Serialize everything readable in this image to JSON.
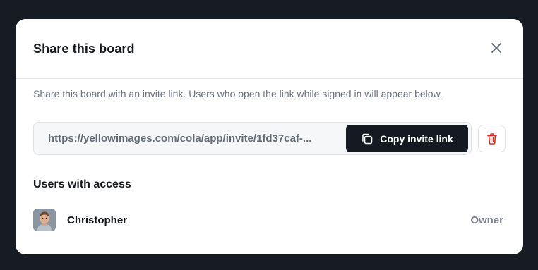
{
  "dialog": {
    "title": "Share this board",
    "description": "Share this board with an invite link. Users who open the link while signed in will appear below.",
    "invite_link": "https://yellowimages.com/cola/app/invite/1fd37caf-...",
    "copy_button_label": "Copy invite link",
    "users_section_title": "Users with access",
    "users": [
      {
        "name": "Christopher",
        "role": "Owner"
      }
    ]
  },
  "icons": {
    "close": "close-icon",
    "copy": "copy-icon",
    "delete": "trash-icon",
    "avatar": "user-avatar"
  },
  "colors": {
    "backdrop": "#161b24",
    "primary_button": "#141922",
    "delete_icon": "#d92d20"
  }
}
